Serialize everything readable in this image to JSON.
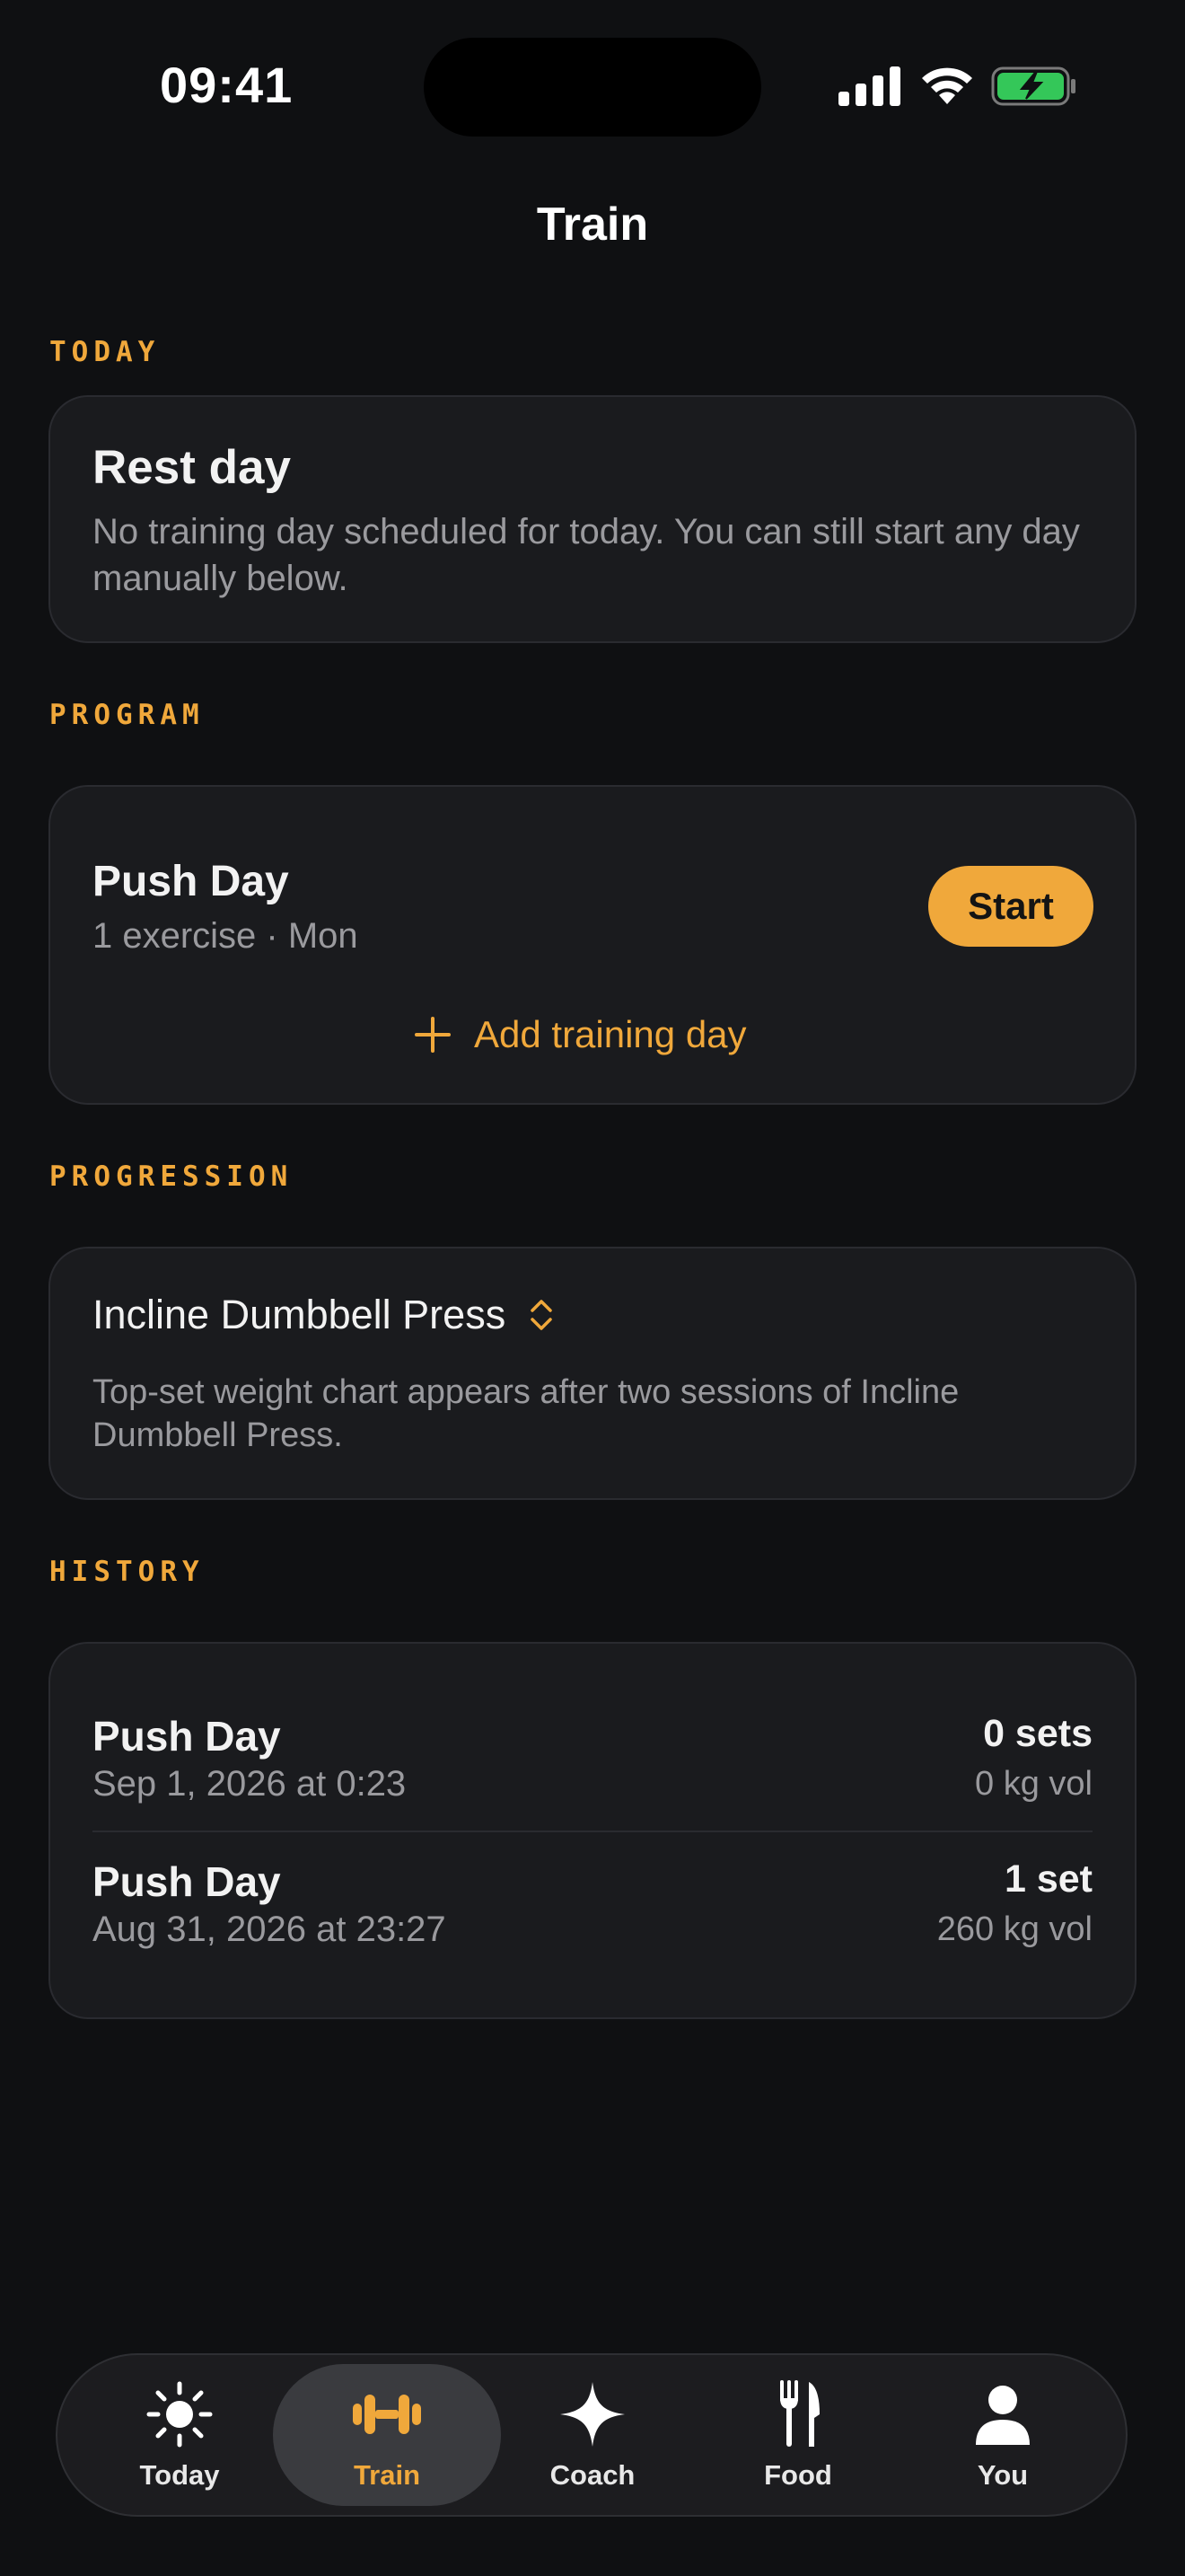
{
  "status_bar": {
    "time": "09:41"
  },
  "header": {
    "title": "Train"
  },
  "today": {
    "section_label": "TODAY",
    "title": "Rest day",
    "description": "No training day scheduled for today. You can still start any day manually below."
  },
  "program": {
    "section_label": "PROGRAM",
    "day_name": "Push Day",
    "day_meta": "1 exercise · Mon",
    "start_label": "Start",
    "add_label": "Add training day"
  },
  "progression": {
    "section_label": "PROGRESSION",
    "exercise": "Incline Dumbbell Press",
    "description": "Top-set weight chart appears after two sessions of Incline Dumbbell Press."
  },
  "history": {
    "section_label": "HISTORY",
    "items": [
      {
        "name": "Push Day",
        "date": "Sep 1, 2026 at 0:23",
        "sets": "0 sets",
        "volume": "0 kg vol"
      },
      {
        "name": "Push Day",
        "date": "Aug 31, 2026 at 23:27",
        "sets": "1 set",
        "volume": "260 kg vol"
      }
    ]
  },
  "tabbar": {
    "tabs": [
      {
        "label": "Today",
        "icon": "sun-icon"
      },
      {
        "label": "Train",
        "icon": "dumbbell-icon",
        "active": true
      },
      {
        "label": "Coach",
        "icon": "sparkle-icon"
      },
      {
        "label": "Food",
        "icon": "fork-knife-icon"
      },
      {
        "label": "You",
        "icon": "person-icon"
      }
    ]
  },
  "colors": {
    "accent": "#f0a83b",
    "background": "#0f1012",
    "card": "#1a1b1e",
    "battery_fill": "#34c759"
  }
}
